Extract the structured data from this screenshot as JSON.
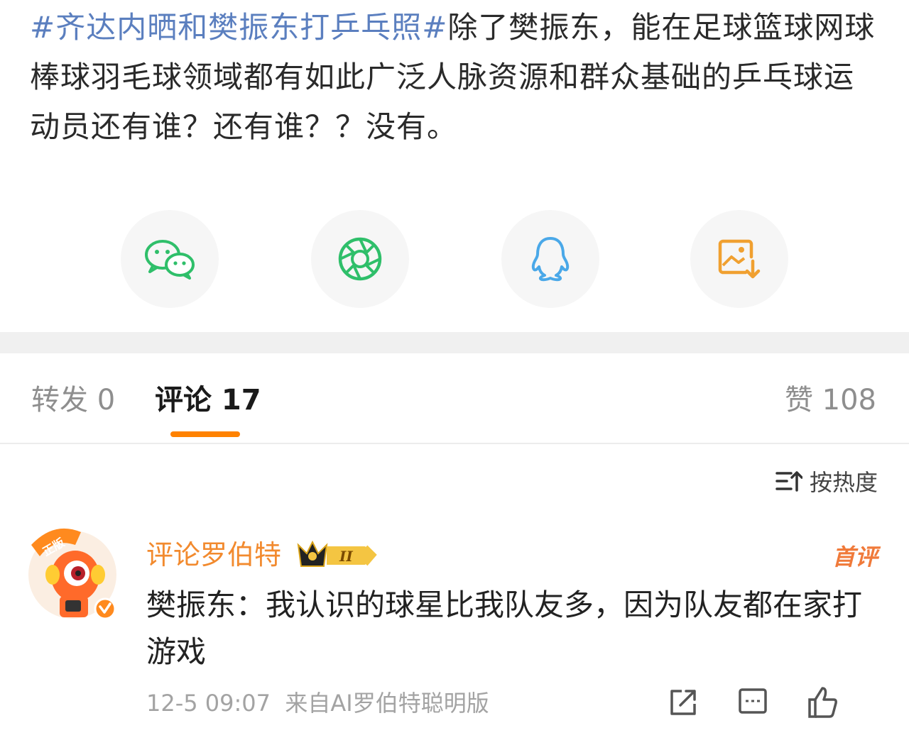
{
  "post": {
    "topic": "#齐达内晒和樊振东打乒乓照#",
    "text": "除了樊振东，能在足球篮球网球棒球羽毛球领域都有如此广泛人脉资源和群众基础的乒乓球运动员还有谁？还有谁？？没有。"
  },
  "share": {
    "items": [
      {
        "icon": "wechat-icon"
      },
      {
        "icon": "moments-icon"
      },
      {
        "icon": "qq-icon"
      },
      {
        "icon": "save-image-icon"
      }
    ]
  },
  "tabs": {
    "repost": "转发 0",
    "comments": "评论 17",
    "likes": "赞 108"
  },
  "sort": {
    "icon": "sort-icon",
    "label": "按热度"
  },
  "comment": {
    "author": "评论罗伯特",
    "badge_icon": "crown-badge-icon",
    "tag": "首评",
    "text": "樊振东：我认识的球星比我队友多，因为队友都在家打游戏",
    "time": "12-5 09:07",
    "source": "来自AI罗伯特聪明版",
    "avatar_badge": "正版",
    "actions": [
      "share-icon",
      "reply-icon",
      "like-icon"
    ]
  },
  "colors": {
    "topic": "#5b7fbf",
    "accent": "#ff8200",
    "author": "#f28a2e",
    "wechat": "#2fbf6a",
    "qq": "#4aa8e8",
    "save": "#f0a030"
  }
}
